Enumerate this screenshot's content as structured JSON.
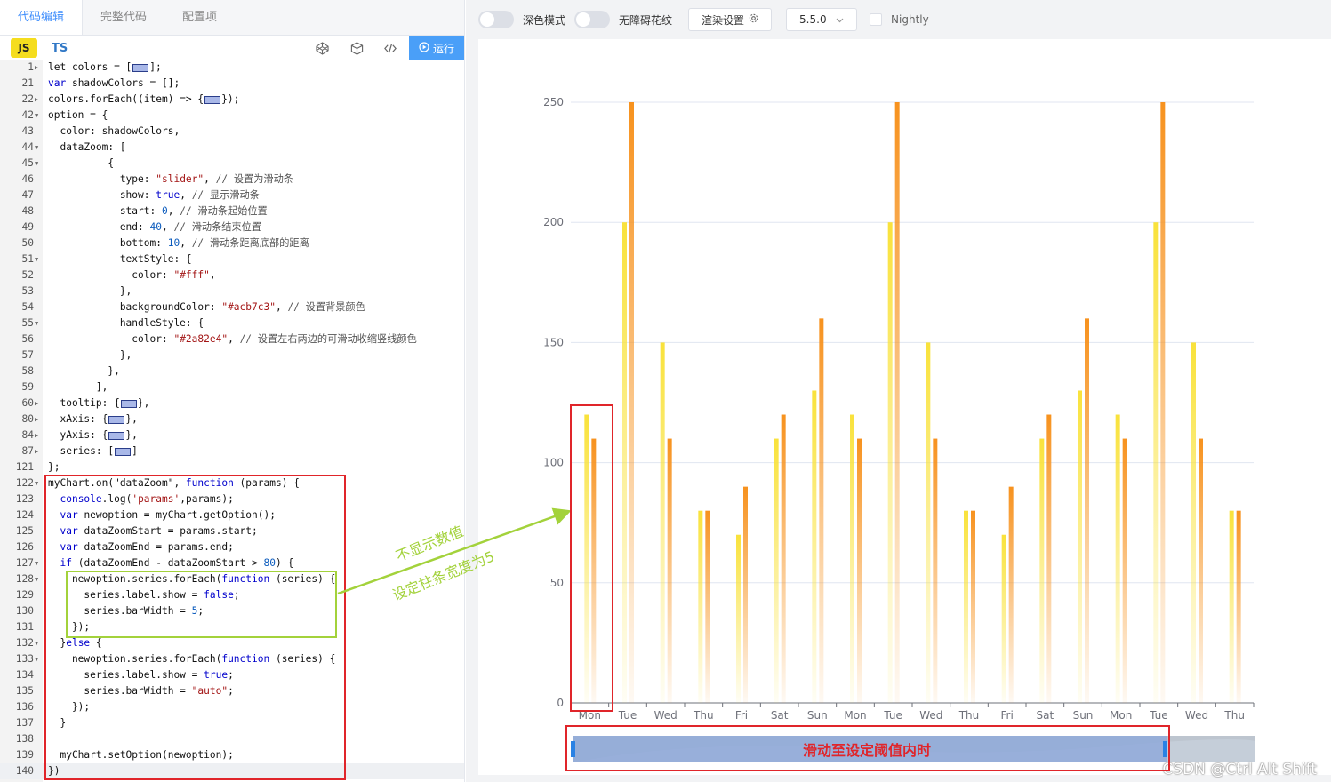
{
  "editor": {
    "tabs": [
      "代码编辑",
      "完整代码",
      "配置项"
    ],
    "lang_js": "JS",
    "lang_ts": "TS",
    "run_label": "运行",
    "lines": [
      {
        "n": "1",
        "f": "r",
        "s": [
          [
            "",
            "let colors = ["
          ],
          [
            "box",
            ""
          ],
          [
            "",
            "];"
          ]
        ]
      },
      {
        "n": "21",
        "f": "",
        "s": [
          [
            "kw",
            "var"
          ],
          [
            "",
            " shadowColors = [];"
          ]
        ]
      },
      {
        "n": "22",
        "f": "r",
        "s": [
          [
            "",
            "colors.forEach((item) => {"
          ],
          [
            "box",
            ""
          ],
          [
            "",
            "});"
          ]
        ]
      },
      {
        "n": "42",
        "f": "d",
        "s": [
          [
            "",
            "option = {"
          ]
        ]
      },
      {
        "n": "43",
        "f": "",
        "s": [
          [
            "",
            "  color: shadowColors,"
          ]
        ]
      },
      {
        "n": "44",
        "f": "d",
        "s": [
          [
            "",
            "  dataZoom: ["
          ]
        ]
      },
      {
        "n": "45",
        "f": "d",
        "s": [
          [
            "",
            "          {"
          ]
        ]
      },
      {
        "n": "46",
        "f": "",
        "s": [
          [
            "",
            "            type: "
          ],
          [
            "st",
            "\"slider\""
          ],
          [
            ",",
            ","
          ],
          [
            "cm",
            " // 设置为滑动条"
          ]
        ]
      },
      {
        "n": "47",
        "f": "",
        "s": [
          [
            "",
            "            show: "
          ],
          [
            "kw",
            "true"
          ],
          [
            "",
            ", "
          ],
          [
            "cm",
            "// 显示滑动条"
          ]
        ]
      },
      {
        "n": "48",
        "f": "",
        "s": [
          [
            "",
            "            start: "
          ],
          [
            "nu",
            "0"
          ],
          [
            "",
            ", "
          ],
          [
            "cm",
            "// 滑动条起始位置"
          ]
        ]
      },
      {
        "n": "49",
        "f": "",
        "s": [
          [
            "",
            "            end: "
          ],
          [
            "nu",
            "40"
          ],
          [
            "",
            ", "
          ],
          [
            "cm",
            "// 滑动条结束位置"
          ]
        ]
      },
      {
        "n": "50",
        "f": "",
        "s": [
          [
            "",
            "            bottom: "
          ],
          [
            "nu",
            "10"
          ],
          [
            "",
            ", "
          ],
          [
            "cm",
            "// 滑动条距离底部的距离"
          ]
        ]
      },
      {
        "n": "51",
        "f": "d",
        "s": [
          [
            "",
            "            textStyle: {"
          ]
        ]
      },
      {
        "n": "52",
        "f": "",
        "s": [
          [
            "",
            "              color: "
          ],
          [
            "st",
            "\"#fff\""
          ],
          [
            "",
            ","
          ]
        ]
      },
      {
        "n": "53",
        "f": "",
        "s": [
          [
            "",
            "            },"
          ]
        ]
      },
      {
        "n": "54",
        "f": "",
        "s": [
          [
            "",
            "            backgroundColor: "
          ],
          [
            "st",
            "\"#acb7c3\""
          ],
          [
            "",
            ", "
          ],
          [
            "cm",
            "// 设置背景颜色"
          ]
        ]
      },
      {
        "n": "55",
        "f": "d",
        "s": [
          [
            "",
            "            handleStyle: {"
          ]
        ]
      },
      {
        "n": "56",
        "f": "",
        "s": [
          [
            "",
            "              color: "
          ],
          [
            "st",
            "\"#2a82e4\""
          ],
          [
            "",
            ", "
          ],
          [
            "cm",
            "// 设置左右两边的可滑动收缩竖线颜色"
          ]
        ]
      },
      {
        "n": "57",
        "f": "",
        "s": [
          [
            "",
            "            },"
          ]
        ]
      },
      {
        "n": "58",
        "f": "",
        "s": [
          [
            "",
            "          },"
          ]
        ]
      },
      {
        "n": "59",
        "f": "",
        "s": [
          [
            "",
            "        ],"
          ]
        ]
      },
      {
        "n": "60",
        "f": "r",
        "s": [
          [
            "",
            "  tooltip: {"
          ],
          [
            "box",
            ""
          ],
          [
            "",
            "},"
          ]
        ]
      },
      {
        "n": "80",
        "f": "r",
        "s": [
          [
            "",
            "  xAxis: {"
          ],
          [
            "box",
            ""
          ],
          [
            "",
            "},"
          ]
        ]
      },
      {
        "n": "84",
        "f": "r",
        "s": [
          [
            "",
            "  yAxis: {"
          ],
          [
            "box",
            ""
          ],
          [
            "",
            "},"
          ]
        ]
      },
      {
        "n": "87",
        "f": "r",
        "s": [
          [
            "",
            "  series: ["
          ],
          [
            "box",
            ""
          ],
          [
            "",
            "]"
          ]
        ]
      },
      {
        "n": "121",
        "f": "",
        "s": [
          [
            "",
            "};"
          ]
        ]
      },
      {
        "n": "122",
        "f": "d",
        "s": [
          [
            "",
            "myChart.on(\"dataZoom\", "
          ],
          [
            "kw",
            "function"
          ],
          [
            "",
            " (params) {"
          ]
        ]
      },
      {
        "n": "123",
        "f": "",
        "s": [
          [
            "",
            "  "
          ],
          [
            "kw",
            "console"
          ],
          [
            "",
            ".log("
          ],
          [
            "st",
            "'params'"
          ],
          [
            "",
            ",params);"
          ]
        ]
      },
      {
        "n": "124",
        "f": "",
        "s": [
          [
            "",
            "  "
          ],
          [
            "kw",
            "var"
          ],
          [
            "",
            " newoption = myChart.getOption();"
          ]
        ]
      },
      {
        "n": "125",
        "f": "",
        "s": [
          [
            "",
            "  "
          ],
          [
            "kw",
            "var"
          ],
          [
            "",
            " dataZoomStart = params.start;"
          ]
        ]
      },
      {
        "n": "126",
        "f": "",
        "s": [
          [
            "",
            "  "
          ],
          [
            "kw",
            "var"
          ],
          [
            "",
            " dataZoomEnd = params.end;"
          ]
        ]
      },
      {
        "n": "127",
        "f": "d",
        "s": [
          [
            "",
            "  "
          ],
          [
            "kw",
            "if"
          ],
          [
            "",
            " (dataZoomEnd - dataZoomStart > "
          ],
          [
            "nu",
            "80"
          ],
          [
            "",
            ") {"
          ]
        ]
      },
      {
        "n": "128",
        "f": "d",
        "s": [
          [
            "",
            "    newoption.series.forEach("
          ],
          [
            "kw",
            "function"
          ],
          [
            "",
            " (series) {"
          ]
        ]
      },
      {
        "n": "129",
        "f": "",
        "s": [
          [
            "",
            "      series.label.show = "
          ],
          [
            "kw",
            "false"
          ],
          [
            "",
            ";"
          ]
        ]
      },
      {
        "n": "130",
        "f": "",
        "s": [
          [
            "",
            "      series.barWidth = "
          ],
          [
            "nu",
            "5"
          ],
          [
            "",
            ";"
          ]
        ]
      },
      {
        "n": "131",
        "f": "",
        "s": [
          [
            "",
            "    });"
          ]
        ]
      },
      {
        "n": "132",
        "f": "d",
        "s": [
          [
            "",
            "  }"
          ],
          [
            "kw",
            "else"
          ],
          [
            "",
            " {"
          ]
        ]
      },
      {
        "n": "133",
        "f": "d",
        "s": [
          [
            "",
            "    newoption.series.forEach("
          ],
          [
            "kw",
            "function"
          ],
          [
            "",
            " (series) {"
          ]
        ]
      },
      {
        "n": "134",
        "f": "",
        "s": [
          [
            "",
            "      series.label.show = "
          ],
          [
            "kw",
            "true"
          ],
          [
            "",
            ";"
          ]
        ]
      },
      {
        "n": "135",
        "f": "",
        "s": [
          [
            "",
            "      series.barWidth = "
          ],
          [
            "st",
            "\"auto\""
          ],
          [
            "",
            ";"
          ]
        ]
      },
      {
        "n": "136",
        "f": "",
        "s": [
          [
            "",
            "    });"
          ]
        ]
      },
      {
        "n": "137",
        "f": "",
        "s": [
          [
            "",
            "  }"
          ]
        ]
      },
      {
        "n": "138",
        "f": "",
        "s": [
          [
            "",
            ""
          ]
        ]
      },
      {
        "n": "139",
        "f": "",
        "s": [
          [
            "",
            "  myChart.setOption(newoption);"
          ]
        ]
      },
      {
        "n": "140",
        "f": "",
        "s": [
          [
            "",
            "})"
          ]
        ]
      }
    ]
  },
  "toolbar": {
    "dark_mode_label": "深色模式",
    "accessible_label": "无障碍花纹",
    "render_settings_label": "渲染设置",
    "version_value": "5.5.0",
    "nightly_label": "Nightly"
  },
  "annotations": {
    "note_line1": "不显示数值",
    "note_line2": "设定柱条宽度为5",
    "slider_note": "滑动至设定阈值内时"
  },
  "watermark": "CSDN @Ctrl Alt Shift",
  "colors": {
    "accent": "#3f8efc",
    "run_button": "#4a9ff8",
    "series_yellow": "#f9e23b",
    "series_orange": "#f7921e",
    "annotation_red": "#e0252a",
    "annotation_green": "#a3d23b",
    "slider_fill": "#8fa9d9",
    "slider_handle": "#2a82e4"
  },
  "chart_data": {
    "type": "bar",
    "categories": [
      "Mon",
      "Tue",
      "Wed",
      "Thu",
      "Fri",
      "Sat",
      "Sun",
      "Mon",
      "Tue",
      "Wed",
      "Thu",
      "Fri",
      "Sat",
      "Sun",
      "Mon",
      "Tue",
      "Wed",
      "Thu"
    ],
    "series": [
      {
        "values": [
          120,
          200,
          150,
          80,
          70,
          110,
          130,
          120,
          200,
          150,
          80,
          70,
          110,
          130,
          120,
          200,
          150,
          80
        ]
      },
      {
        "values": [
          110,
          250,
          110,
          80,
          90,
          120,
          160,
          110,
          250,
          110,
          80,
          90,
          120,
          160,
          110,
          250,
          110,
          80
        ]
      }
    ],
    "yticks": [
      0,
      50,
      100,
      150,
      200,
      250
    ],
    "ylim": [
      0,
      250
    ],
    "grid": true,
    "datazoom": {
      "type": "slider",
      "start": 0,
      "end": 100
    }
  }
}
